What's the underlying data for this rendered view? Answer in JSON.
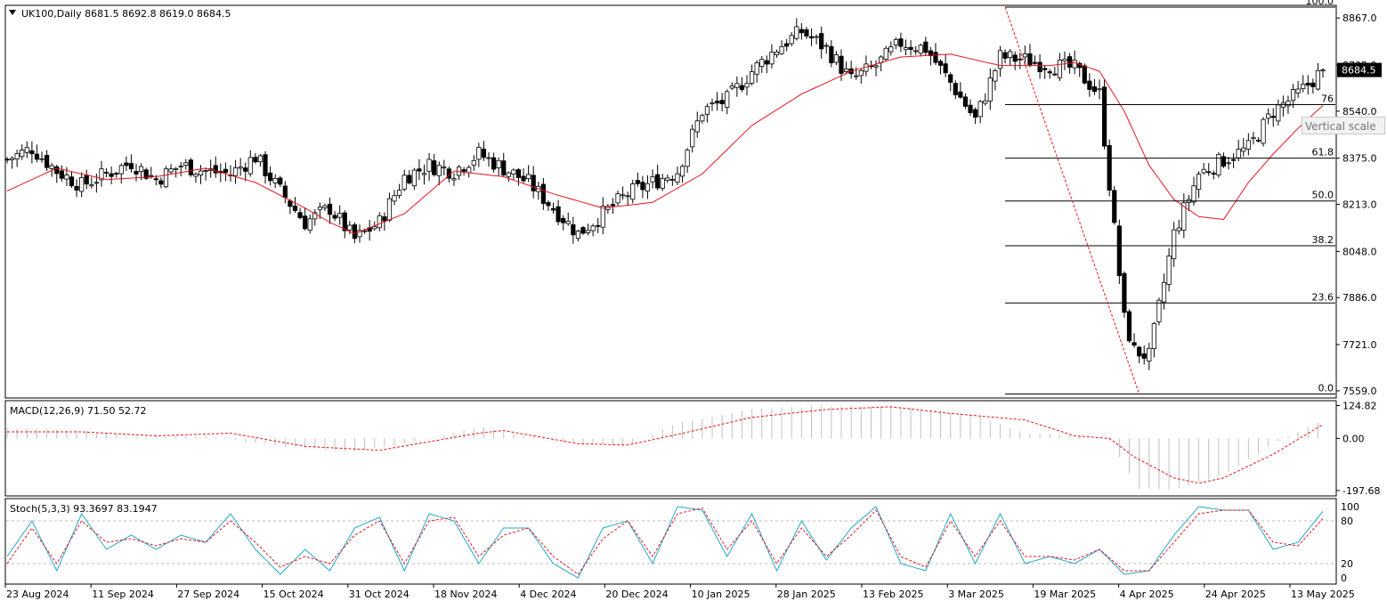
{
  "header": {
    "symbol_line": "UK100,Daily  8681.5 8692.8 8619.0 8684.5",
    "macd_label": "MACD(12,26,9) 71.50 52.72",
    "stoch_label": "Stoch(5,3,3) 93.3697 83.1947"
  },
  "tooltip": "Vertical scale",
  "colors": {
    "ma": "#e8141e",
    "signal": "#e8141e",
    "stoch_main": "#1fa8c9",
    "hist": "#c0c0c0",
    "price_label_bg": "#000000",
    "fib": "#000000"
  },
  "chart_data": {
    "type": "candlestick",
    "symbol": "UK100",
    "timeframe": "Daily",
    "last_ohlc": {
      "open": 8681.5,
      "high": 8692.8,
      "low": 8619.0,
      "close": 8684.5
    },
    "current_price_label": "8684.5",
    "price_axis": {
      "ticks": [
        "8867.0",
        "8702.0",
        "8540.0",
        "8375.0",
        "8213.0",
        "8048.0",
        "7886.0",
        "7721.0",
        "7559.0"
      ],
      "range": [
        7540,
        8905
      ]
    },
    "x_axis": {
      "labels": [
        "23 Aug 2024",
        "11 Sep 2024",
        "27 Sep 2024",
        "15 Oct 2024",
        "31 Oct 2024",
        "18 Nov 2024",
        "4 Dec 2024",
        "20 Dec 2024",
        "10 Jan 2025",
        "28 Jan 2025",
        "13 Feb 2025",
        "3 Mar 2025",
        "19 Mar 2025",
        "4 Apr 2025",
        "24 Apr 2025",
        "13 May 2025"
      ]
    },
    "close_path": [
      [
        0,
        8370
      ],
      [
        5,
        8410
      ],
      [
        10,
        8330
      ],
      [
        15,
        8280
      ],
      [
        20,
        8320
      ],
      [
        25,
        8360
      ],
      [
        30,
        8300
      ],
      [
        35,
        8350
      ],
      [
        40,
        8330
      ],
      [
        45,
        8320
      ],
      [
        50,
        8380
      ],
      [
        55,
        8260
      ],
      [
        60,
        8150
      ],
      [
        65,
        8200
      ],
      [
        70,
        8090
      ],
      [
        75,
        8150
      ],
      [
        80,
        8310
      ],
      [
        85,
        8350
      ],
      [
        90,
        8330
      ],
      [
        95,
        8390
      ],
      [
        100,
        8340
      ],
      [
        105,
        8290
      ],
      [
        110,
        8200
      ],
      [
        115,
        8110
      ],
      [
        120,
        8180
      ],
      [
        125,
        8250
      ],
      [
        130,
        8290
      ],
      [
        135,
        8330
      ],
      [
        140,
        8540
      ],
      [
        145,
        8580
      ],
      [
        150,
        8680
      ],
      [
        155,
        8760
      ],
      [
        160,
        8820
      ],
      [
        165,
        8760
      ],
      [
        170,
        8650
      ],
      [
        175,
        8700
      ],
      [
        180,
        8780
      ],
      [
        185,
        8760
      ],
      [
        190,
        8640
      ],
      [
        195,
        8510
      ],
      [
        200,
        8730
      ],
      [
        205,
        8720
      ],
      [
        210,
        8700
      ],
      [
        215,
        8690
      ],
      [
        220,
        8600
      ],
      [
        225,
        7810
      ],
      [
        227,
        7700
      ],
      [
        230,
        7680
      ],
      [
        235,
        8110
      ],
      [
        240,
        8320
      ],
      [
        245,
        8370
      ],
      [
        250,
        8410
      ],
      [
        255,
        8540
      ],
      [
        260,
        8600
      ],
      [
        265,
        8684.5
      ]
    ],
    "ma_path": [
      [
        0,
        8260
      ],
      [
        10,
        8340
      ],
      [
        20,
        8300
      ],
      [
        30,
        8310
      ],
      [
        40,
        8340
      ],
      [
        50,
        8290
      ],
      [
        60,
        8200
      ],
      [
        65,
        8150
      ],
      [
        70,
        8110
      ],
      [
        80,
        8180
      ],
      [
        90,
        8330
      ],
      [
        100,
        8310
      ],
      [
        110,
        8250
      ],
      [
        120,
        8200
      ],
      [
        130,
        8220
      ],
      [
        140,
        8320
      ],
      [
        150,
        8490
      ],
      [
        160,
        8600
      ],
      [
        170,
        8680
      ],
      [
        180,
        8730
      ],
      [
        190,
        8740
      ],
      [
        200,
        8700
      ],
      [
        210,
        8700
      ],
      [
        215,
        8710
      ],
      [
        220,
        8680
      ],
      [
        225,
        8540
      ],
      [
        230,
        8350
      ],
      [
        235,
        8230
      ],
      [
        240,
        8170
      ],
      [
        245,
        8160
      ],
      [
        250,
        8290
      ],
      [
        255,
        8390
      ],
      [
        260,
        8480
      ],
      [
        265,
        8560
      ]
    ],
    "fibonacci": {
      "levels": [
        {
          "label": "100.0",
          "price": 8905
        },
        {
          "label": "76",
          "price": 8563
        },
        {
          "label": "61.8",
          "price": 8375
        },
        {
          "label": "50.0",
          "price": 8225
        },
        {
          "label": "38.2",
          "price": 8068
        },
        {
          "label": "23.6",
          "price": 7867
        },
        {
          "label": "0.0",
          "price": 7548
        }
      ],
      "trend_from": {
        "price": 8905
      },
      "trend_to": {
        "price": 7548
      }
    },
    "macd": {
      "axis_ticks": [
        "124.82",
        "0.00",
        "-197.68"
      ],
      "range": [
        -215,
        140
      ],
      "hist_path": [
        [
          0,
          40
        ],
        [
          15,
          30
        ],
        [
          25,
          5
        ],
        [
          40,
          10
        ],
        [
          55,
          -30
        ],
        [
          70,
          -50
        ],
        [
          80,
          -20
        ],
        [
          95,
          45
        ],
        [
          110,
          -10
        ],
        [
          125,
          -30
        ],
        [
          135,
          60
        ],
        [
          150,
          110
        ],
        [
          165,
          125
        ],
        [
          180,
          120
        ],
        [
          195,
          90
        ],
        [
          205,
          20
        ],
        [
          215,
          10
        ],
        [
          222,
          -10
        ],
        [
          228,
          -190
        ],
        [
          235,
          -195
        ],
        [
          245,
          -140
        ],
        [
          255,
          -20
        ],
        [
          265,
          71.5
        ]
      ],
      "signal_path": [
        [
          0,
          25
        ],
        [
          15,
          25
        ],
        [
          30,
          10
        ],
        [
          45,
          20
        ],
        [
          60,
          -30
        ],
        [
          75,
          -45
        ],
        [
          95,
          20
        ],
        [
          100,
          30
        ],
        [
          115,
          -20
        ],
        [
          125,
          -25
        ],
        [
          135,
          15
        ],
        [
          150,
          80
        ],
        [
          165,
          110
        ],
        [
          178,
          120
        ],
        [
          190,
          95
        ],
        [
          205,
          70
        ],
        [
          215,
          10
        ],
        [
          222,
          0
        ],
        [
          227,
          -70
        ],
        [
          235,
          -150
        ],
        [
          240,
          -170
        ],
        [
          245,
          -150
        ],
        [
          255,
          -60
        ],
        [
          265,
          52.72
        ]
      ]
    },
    "stochastic": {
      "axis_ticks": [
        "100",
        "80",
        "20",
        "0"
      ],
      "levels": [
        80,
        20
      ],
      "main_path": [
        [
          0,
          30
        ],
        [
          5,
          80
        ],
        [
          10,
          10
        ],
        [
          15,
          90
        ],
        [
          20,
          40
        ],
        [
          25,
          60
        ],
        [
          30,
          40
        ],
        [
          35,
          60
        ],
        [
          40,
          50
        ],
        [
          45,
          90
        ],
        [
          50,
          40
        ],
        [
          55,
          5
        ],
        [
          60,
          40
        ],
        [
          65,
          10
        ],
        [
          70,
          70
        ],
        [
          75,
          85
        ],
        [
          80,
          10
        ],
        [
          85,
          90
        ],
        [
          90,
          80
        ],
        [
          95,
          20
        ],
        [
          100,
          70
        ],
        [
          105,
          70
        ],
        [
          110,
          20
        ],
        [
          115,
          0
        ],
        [
          120,
          70
        ],
        [
          125,
          80
        ],
        [
          130,
          20
        ],
        [
          135,
          100
        ],
        [
          140,
          95
        ],
        [
          145,
          30
        ],
        [
          150,
          90
        ],
        [
          155,
          10
        ],
        [
          160,
          80
        ],
        [
          165,
          25
        ],
        [
          170,
          70
        ],
        [
          175,
          100
        ],
        [
          180,
          20
        ],
        [
          185,
          10
        ],
        [
          190,
          90
        ],
        [
          195,
          20
        ],
        [
          200,
          90
        ],
        [
          205,
          20
        ],
        [
          210,
          30
        ],
        [
          215,
          20
        ],
        [
          220,
          40
        ],
        [
          225,
          5
        ],
        [
          230,
          10
        ],
        [
          235,
          60
        ],
        [
          240,
          100
        ],
        [
          245,
          95
        ],
        [
          250,
          95
        ],
        [
          255,
          40
        ],
        [
          260,
          50
        ],
        [
          265,
          93.37
        ]
      ],
      "signal_path": [
        [
          0,
          20
        ],
        [
          5,
          70
        ],
        [
          10,
          20
        ],
        [
          15,
          80
        ],
        [
          20,
          50
        ],
        [
          25,
          55
        ],
        [
          30,
          45
        ],
        [
          35,
          55
        ],
        [
          40,
          50
        ],
        [
          45,
          80
        ],
        [
          50,
          50
        ],
        [
          55,
          15
        ],
        [
          60,
          30
        ],
        [
          65,
          20
        ],
        [
          70,
          60
        ],
        [
          75,
          80
        ],
        [
          80,
          20
        ],
        [
          85,
          80
        ],
        [
          90,
          85
        ],
        [
          95,
          30
        ],
        [
          100,
          60
        ],
        [
          105,
          70
        ],
        [
          110,
          30
        ],
        [
          115,
          5
        ],
        [
          120,
          55
        ],
        [
          125,
          80
        ],
        [
          130,
          30
        ],
        [
          135,
          90
        ],
        [
          140,
          98
        ],
        [
          145,
          40
        ],
        [
          150,
          80
        ],
        [
          155,
          20
        ],
        [
          160,
          70
        ],
        [
          165,
          30
        ],
        [
          170,
          60
        ],
        [
          175,
          95
        ],
        [
          180,
          30
        ],
        [
          185,
          15
        ],
        [
          190,
          80
        ],
        [
          195,
          30
        ],
        [
          200,
          80
        ],
        [
          205,
          30
        ],
        [
          210,
          30
        ],
        [
          215,
          25
        ],
        [
          220,
          40
        ],
        [
          225,
          10
        ],
        [
          230,
          10
        ],
        [
          235,
          50
        ],
        [
          240,
          90
        ],
        [
          245,
          95
        ],
        [
          250,
          95
        ],
        [
          255,
          50
        ],
        [
          260,
          45
        ],
        [
          265,
          83.19
        ]
      ]
    }
  }
}
